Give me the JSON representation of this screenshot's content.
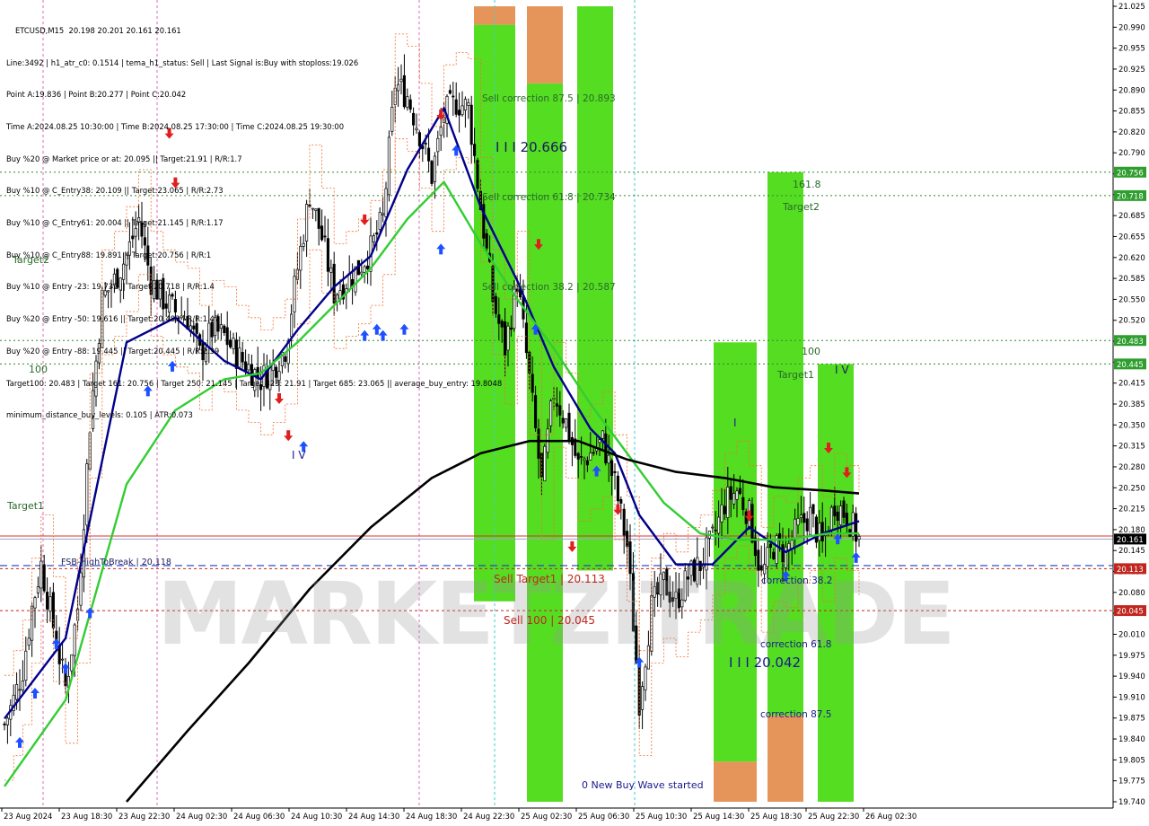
{
  "header": {
    "symbol_line": "ETCUSD,M15  20.198 20.201 20.161 20.161",
    "info_lines": [
      "Line:3492 | h1_atr_c0: 0.1514 | tema_h1_status: Sell | Last Signal is:Buy with stoploss:19.026",
      "Point A:19.836 | Point B:20.277 | Point C:20.042",
      "Time A:2024.08.25 10:30:00 | Time B:2024.08.25 17:30:00 | Time C:2024.08.25 19:30:00",
      "Buy %20 @ Market price or at: 20.095 || Target:21.91 | R/R:1.7",
      "Buy %10 @ C_Entry38: 20.109 || Target:23.065 | R/R:2.73",
      "Buy %10 @ C_Entry61: 20.004 || Target:21.145 | R/R:1.17",
      "Buy %10 @ C_Entry88: 19.891 || Target:20.756 | R/R:1",
      "Buy %10 @ Entry -23: 19.732 || Target:20.718 | R/R:1.4",
      "Buy %20 @ Entry -50: 19.616 || Target:20.483 | R/R:1.47",
      "Buy %20 @ Entry -88: 19.445 || Target:20.445 | R/R:2.39",
      "Target100: 20.483 | Target 161: 20.756 | Target 250: 21.145 | Target 423: 21.91 | Target 685: 23.065 || average_buy_entry: 19.8048",
      "minimum_distance_buy_levels: 0.105 | ATR:0.073"
    ]
  },
  "watermark": "MARKETZITRADE",
  "annotations": {
    "sell_corr_875": "Sell correction 87.5 | 20.893",
    "sell_corr_618": "Sell correction 61.8 | 20.734",
    "sell_corr_382": "Sell correction 38.2 | 20.587",
    "wave3_top": "I I I 20.666",
    "sell_target1": "Sell Target1 | 20.113",
    "sell_100": "Sell 100 | 20.045",
    "fsb": "FSB-HighToBreak | 20.118",
    "target2_left": "Target2",
    "target1_left": "Target1",
    "hundred_left": "100",
    "wave4_left": "I V",
    "lvl_1618": "161.8",
    "target2_right": "Target2",
    "hundred_right": "100",
    "target1_right": "Target1",
    "wave1": "I",
    "wave4_right": "I V",
    "corr_382": "correction 38.2",
    "corr_618": "correction 61.8",
    "corr_875": "correction 87.5",
    "wave3_low": "I I I 20.042",
    "new_buy_wave": "0 New Buy Wave started"
  },
  "chart_data": {
    "type": "candlestick",
    "symbol": "ETCUSD",
    "timeframe": "M15",
    "ylim": [
      19.735,
      21.025
    ],
    "y_ticks": [
      "21.025",
      "20.990",
      "20.955",
      "20.925",
      "20.890",
      "20.855",
      "20.820",
      "20.790",
      "20.755",
      "20.720",
      "20.685",
      "20.655",
      "20.620",
      "20.585",
      "20.550",
      "20.520",
      "20.485",
      "20.450",
      "20.415",
      "20.385",
      "20.350",
      "20.315",
      "20.280",
      "20.250",
      "20.215",
      "20.180",
      "20.145",
      "20.110",
      "20.080",
      "20.045",
      "20.010",
      "19.975",
      "19.940",
      "19.910",
      "19.875",
      "19.840",
      "19.805",
      "19.775",
      "19.740"
    ],
    "x_ticks": [
      "23 Aug 2024",
      "23 Aug 18:30",
      "23 Aug 22:30",
      "24 Aug 02:30",
      "24 Aug 06:30",
      "24 Aug 10:30",
      "24 Aug 14:30",
      "24 Aug 18:30",
      "24 Aug 22:30",
      "25 Aug 02:30",
      "25 Aug 06:30",
      "25 Aug 10:30",
      "25 Aug 14:30",
      "25 Aug 18:30",
      "25 Aug 22:30",
      "26 Aug 02:30"
    ],
    "price_tags": [
      {
        "value": "20.756",
        "color": "#2e9e2e"
      },
      {
        "value": "20.718",
        "color": "#2e9e2e"
      },
      {
        "value": "20.483",
        "color": "#2e9e2e"
      },
      {
        "value": "20.445",
        "color": "#2e9e2e"
      },
      {
        "value": "20.161",
        "color": "#000000"
      },
      {
        "value": "20.113",
        "color": "#c0261e"
      },
      {
        "value": "20.045",
        "color": "#c0261e"
      }
    ],
    "levels": {
      "target161": 20.756,
      "target_7188": 20.718,
      "target100": 20.483,
      "target_445": 20.445,
      "current": 20.161,
      "red_line": 20.166,
      "blue_dashed": 20.118,
      "sell_target1": 20.113,
      "sell_100": 20.045
    },
    "path_closes": [
      [
        0,
        19.86
      ],
      [
        3,
        19.9
      ],
      [
        6,
        19.95
      ],
      [
        9,
        20.05
      ],
      [
        12,
        20.12
      ],
      [
        16,
        20.02
      ],
      [
        20,
        19.92
      ],
      [
        24,
        20.05
      ],
      [
        28,
        20.35
      ],
      [
        32,
        20.55
      ],
      [
        36,
        20.58
      ],
      [
        40,
        20.62
      ],
      [
        44,
        20.68
      ],
      [
        48,
        20.58
      ],
      [
        52,
        20.55
      ],
      [
        56,
        20.53
      ],
      [
        60,
        20.52
      ],
      [
        64,
        20.46
      ],
      [
        68,
        20.5
      ],
      [
        72,
        20.49
      ],
      [
        76,
        20.46
      ],
      [
        80,
        20.44
      ],
      [
        84,
        20.42
      ],
      [
        88,
        20.44
      ],
      [
        92,
        20.47
      ],
      [
        96,
        20.6
      ],
      [
        100,
        20.72
      ],
      [
        104,
        20.65
      ],
      [
        108,
        20.56
      ],
      [
        112,
        20.58
      ],
      [
        116,
        20.6
      ],
      [
        120,
        20.63
      ],
      [
        124,
        20.68
      ],
      [
        128,
        20.9
      ],
      [
        132,
        20.88
      ],
      [
        136,
        20.82
      ],
      [
        140,
        20.75
      ],
      [
        144,
        20.85
      ],
      [
        148,
        20.87
      ],
      [
        152,
        20.86
      ],
      [
        156,
        20.7
      ],
      [
        160,
        20.55
      ],
      [
        164,
        20.47
      ],
      [
        168,
        20.58
      ],
      [
        172,
        20.42
      ],
      [
        176,
        20.25
      ],
      [
        180,
        20.4
      ],
      [
        184,
        20.35
      ],
      [
        188,
        20.28
      ],
      [
        192,
        20.3
      ],
      [
        196,
        20.32
      ],
      [
        200,
        20.25
      ],
      [
        204,
        20.15
      ],
      [
        208,
        19.9
      ],
      [
        212,
        20.05
      ],
      [
        216,
        20.09
      ],
      [
        220,
        20.06
      ],
      [
        224,
        20.1
      ],
      [
        228,
        20.12
      ],
      [
        232,
        20.16
      ],
      [
        236,
        20.22
      ],
      [
        240,
        20.24
      ],
      [
        244,
        20.2
      ],
      [
        248,
        20.1
      ],
      [
        252,
        20.15
      ],
      [
        256,
        20.14
      ],
      [
        260,
        20.18
      ],
      [
        264,
        20.2
      ],
      [
        268,
        20.15
      ],
      [
        272,
        20.22
      ],
      [
        276,
        20.2
      ],
      [
        280,
        20.16
      ]
    ],
    "series": [
      {
        "name": "",
        "color": "#00008b",
        "points": [
          [
            0,
            19.87
          ],
          [
            20,
            20.0
          ],
          [
            40,
            20.48
          ],
          [
            56,
            20.52
          ],
          [
            72,
            20.45
          ],
          [
            84,
            20.42
          ],
          [
            96,
            20.5
          ],
          [
            108,
            20.57
          ],
          [
            120,
            20.62
          ],
          [
            132,
            20.76
          ],
          [
            144,
            20.86
          ],
          [
            156,
            20.7
          ],
          [
            168,
            20.58
          ],
          [
            180,
            20.44
          ],
          [
            192,
            20.34
          ],
          [
            200,
            20.3
          ],
          [
            208,
            20.2
          ],
          [
            220,
            20.12
          ],
          [
            232,
            20.12
          ],
          [
            244,
            20.18
          ],
          [
            256,
            20.14
          ],
          [
            268,
            20.17
          ],
          [
            280,
            20.19
          ]
        ]
      },
      {
        "name": "",
        "color": "#32cd32",
        "points": [
          [
            0,
            19.76
          ],
          [
            20,
            19.9
          ],
          [
            40,
            20.25
          ],
          [
            56,
            20.37
          ],
          [
            72,
            20.42
          ],
          [
            84,
            20.43
          ],
          [
            96,
            20.48
          ],
          [
            108,
            20.54
          ],
          [
            120,
            20.6
          ],
          [
            132,
            20.68
          ],
          [
            144,
            20.74
          ],
          [
            156,
            20.64
          ],
          [
            168,
            20.55
          ],
          [
            180,
            20.47
          ],
          [
            192,
            20.38
          ],
          [
            204,
            20.3
          ],
          [
            216,
            20.22
          ],
          [
            228,
            20.17
          ],
          [
            240,
            20.16
          ],
          [
            256,
            20.16
          ],
          [
            270,
            20.17
          ],
          [
            280,
            20.17
          ]
        ]
      },
      {
        "name": "",
        "color": "#000000",
        "points": [
          [
            40,
            19.735
          ],
          [
            60,
            19.85
          ],
          [
            80,
            19.96
          ],
          [
            100,
            20.08
          ],
          [
            120,
            20.18
          ],
          [
            140,
            20.26
          ],
          [
            156,
            20.3
          ],
          [
            172,
            20.32
          ],
          [
            188,
            20.32
          ],
          [
            204,
            20.29
          ],
          [
            220,
            20.27
          ],
          [
            236,
            20.26
          ],
          [
            252,
            20.245
          ],
          [
            268,
            20.24
          ],
          [
            280,
            20.235
          ]
        ]
      }
    ]
  }
}
